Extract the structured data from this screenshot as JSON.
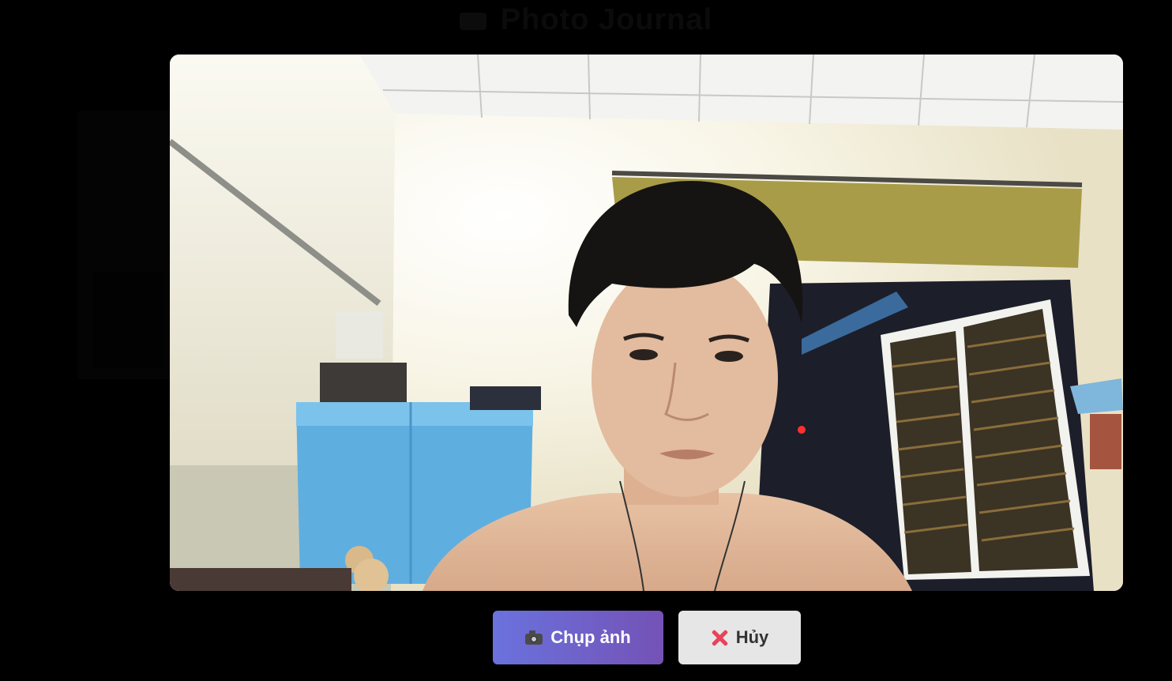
{
  "app": {
    "background_title": "Photo Journal"
  },
  "camera": {
    "feed_description_icon": "camera-feed"
  },
  "controls": {
    "capture_label": "Chụp ảnh",
    "capture_icon": "camera-icon",
    "cancel_label": "Hủy",
    "cancel_icon": "close-x-icon"
  },
  "colors": {
    "capture_gradient_start": "#6a72dd",
    "capture_gradient_end": "#7452b6",
    "cancel_bg": "#e6e6e6",
    "cancel_x": "#e8435a",
    "overlay_bg": "#000000"
  }
}
